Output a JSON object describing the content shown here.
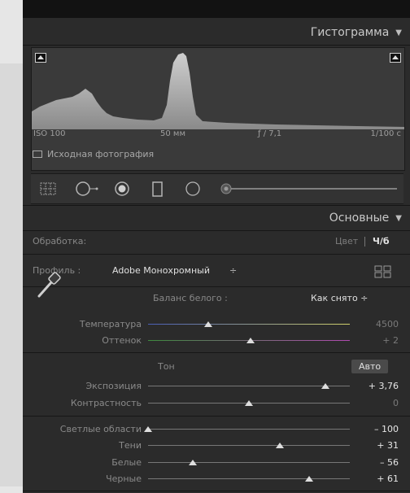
{
  "histogram_panel": {
    "title": "Гистограмма",
    "iso": "ISO 100",
    "focal": "50 мм",
    "aperture": "ƒ / 7,1",
    "shutter": "1/100 с",
    "original_photo_label": "Исходная фотография"
  },
  "tools": [
    "grid-crop-icon",
    "spot-removal-icon",
    "red-eye-icon",
    "graduated-filter-icon",
    "radial-filter-icon",
    "adjustment-brush-icon"
  ],
  "basic_panel": {
    "title": "Основные",
    "treatment_label": "Обработка:",
    "treatment_color": "Цвет",
    "treatment_bw": "Ч/б",
    "profile_label": "Профиль :",
    "profile_value": "Adobe Монохромный",
    "profile_arrow": "÷",
    "wb_label": "Баланс белого :",
    "wb_value": "Как снято ÷",
    "tone_label": "Тон",
    "auto_button": "Авто",
    "sliders": [
      {
        "label": "Температура",
        "value": "4500",
        "level": 0.3
      },
      {
        "label": "Оттенок",
        "value": "+ 2",
        "level": 0.51
      },
      {
        "label": "Экспозиция",
        "value": "+ 3,76",
        "level": 0.88
      },
      {
        "label": "Контрастность",
        "value": "0",
        "level": 0.5
      },
      {
        "label": "Светлые области",
        "value": "– 100",
        "level": 0.0
      },
      {
        "label": "Тени",
        "value": "+ 31",
        "level": 0.655
      },
      {
        "label": "Белые",
        "value": "– 56",
        "level": 0.22
      },
      {
        "label": "Черные",
        "value": "+ 61",
        "level": 0.8
      }
    ]
  }
}
